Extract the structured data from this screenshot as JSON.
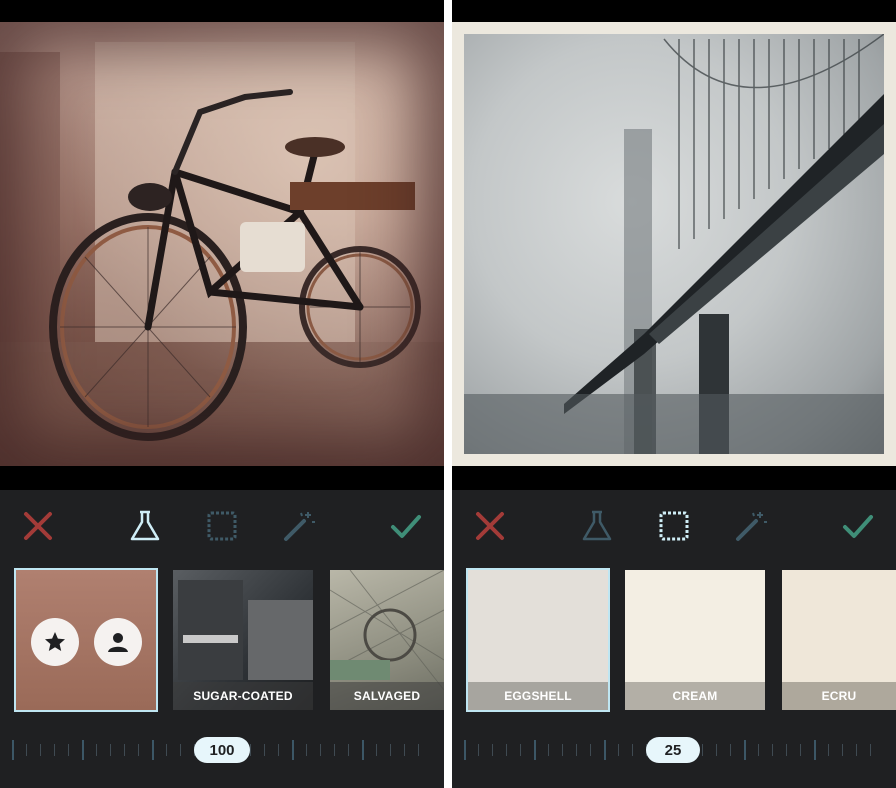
{
  "left_screen": {
    "toolbar": {
      "cancel_icon": "x-icon",
      "filters_icon": "flask-icon",
      "frames_icon": "frame-icon",
      "adjust_icon": "magic-wand-icon",
      "confirm_icon": "checkmark-icon",
      "active_tool": "filters"
    },
    "thumbnails": [
      {
        "label": "",
        "type": "favorites",
        "icons": [
          "star-icon",
          "person-icon"
        ],
        "color": "#a77563"
      },
      {
        "label": "SUGAR-COATED",
        "type": "filter"
      },
      {
        "label": "SALVAGED",
        "type": "filter"
      }
    ],
    "intensity": "100",
    "intensity_fraction": 0.5
  },
  "right_screen": {
    "toolbar": {
      "cancel_icon": "x-icon",
      "filters_icon": "flask-icon",
      "frames_icon": "frame-icon",
      "adjust_icon": "magic-wand-icon",
      "confirm_icon": "checkmark-icon",
      "active_tool": "frames"
    },
    "thumbnails": [
      {
        "label": "EGGSHELL",
        "color": "#e3dfd9"
      },
      {
        "label": "CREAM",
        "color": "#f3eee3"
      },
      {
        "label": "ECRU",
        "color": "#efe7d9"
      }
    ],
    "intensity": "25",
    "intensity_fraction": 0.5
  },
  "colors": {
    "cancel": "#a33b38",
    "confirm": "#3f8e78",
    "active_tool": "#cfeef7",
    "inactive_tool": "#3f5a67",
    "selection_outline": "#bfe6f2"
  }
}
